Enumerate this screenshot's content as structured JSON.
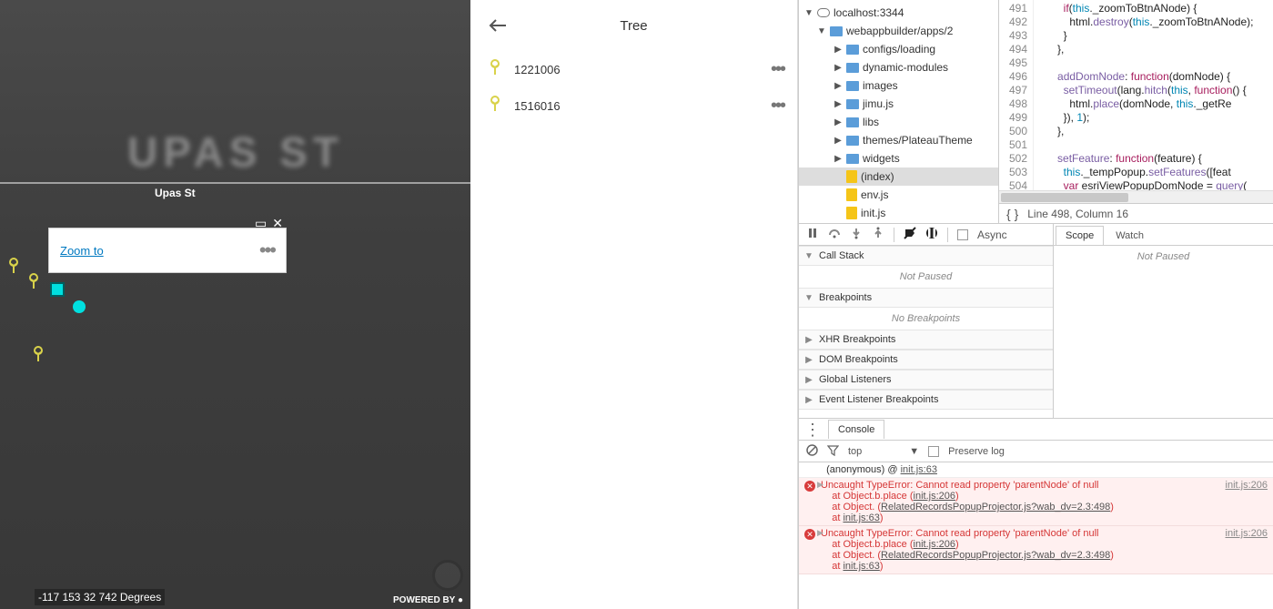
{
  "map": {
    "street": "Upas St",
    "ghost": "UPAS ST",
    "popup_link": "Zoom to",
    "coords": "-117 153 32 742 Degrees",
    "powered": "POWERED BY"
  },
  "list": {
    "title": "Tree",
    "items": [
      {
        "label": "1221006"
      },
      {
        "label": "1516016"
      }
    ]
  },
  "devtools": {
    "sources": {
      "domain": "localhost:3344",
      "nodes": [
        {
          "label": "webappbuilder/apps/2",
          "type": "folder-open",
          "indent": 1,
          "expand": "▼"
        },
        {
          "label": "configs/loading",
          "type": "folder",
          "indent": 2,
          "expand": "▶"
        },
        {
          "label": "dynamic-modules",
          "type": "folder",
          "indent": 2,
          "expand": "▶"
        },
        {
          "label": "images",
          "type": "folder",
          "indent": 2,
          "expand": "▶"
        },
        {
          "label": "jimu.js",
          "type": "folder",
          "indent": 2,
          "expand": "▶"
        },
        {
          "label": "libs",
          "type": "folder",
          "indent": 2,
          "expand": "▶"
        },
        {
          "label": "themes/PlateauTheme",
          "type": "folder",
          "indent": 2,
          "expand": "▶"
        },
        {
          "label": "widgets",
          "type": "folder",
          "indent": 2,
          "expand": "▶"
        },
        {
          "label": "(index)",
          "type": "file",
          "indent": 2,
          "selected": true
        },
        {
          "label": "env.js",
          "type": "file",
          "indent": 2
        },
        {
          "label": "init.js",
          "type": "file",
          "indent": 2
        }
      ]
    },
    "code": {
      "first_line": 491,
      "lines": [
        "        if(this._zoomToBtnANode) {",
        "          html.destroy(this._zoomToBtnANode);",
        "        }",
        "      },",
        "",
        "      addDomNode: function(domNode) {",
        "        setTimeout(lang.hitch(this, function() {",
        "          html.place(domNode, this._getRe",
        "        }), 1);",
        "      },",
        "",
        "      setFeature: function(feature) {",
        "        this._tempPopup.setFeatures([feat",
        "        var esriViewPopupDomNode = query(",
        ""
      ],
      "status": "Line 498, Column 16"
    },
    "debugger": {
      "async": "Async",
      "panels": [
        {
          "title": "Call Stack",
          "msg": "Not Paused",
          "open": true
        },
        {
          "title": "Breakpoints",
          "msg": "No Breakpoints",
          "open": true
        },
        {
          "title": "XHR Breakpoints"
        },
        {
          "title": "DOM Breakpoints"
        },
        {
          "title": "Global Listeners"
        },
        {
          "title": "Event Listener Breakpoints"
        }
      ],
      "right": {
        "tabs": [
          "Scope",
          "Watch"
        ],
        "msg": "Not Paused"
      }
    },
    "console": {
      "tab": "Console",
      "context": "top",
      "preserve": "Preserve log",
      "lines": [
        {
          "type": "norm",
          "text": "(anonymous) @ ",
          "link": "init.js:63"
        },
        {
          "type": "err",
          "head": "Uncaught TypeError: Cannot read property 'parentNode' of null",
          "src": "init.js:206",
          "stack": [
            {
              "label": "at Object.b.place (",
              "link": "init.js:206"
            },
            {
              "label": "at Object.<anonymous> (",
              "link": "RelatedRecordsPopupProjector.js?wab_dv=2.3:498"
            },
            {
              "label": "at ",
              "link": "init.js:63"
            }
          ]
        },
        {
          "type": "err",
          "head": "Uncaught TypeError: Cannot read property 'parentNode' of null",
          "src": "init.js:206",
          "stack": [
            {
              "label": "at Object.b.place (",
              "link": "init.js:206"
            },
            {
              "label": "at Object.<anonymous> (",
              "link": "RelatedRecordsPopupProjector.js?wab_dv=2.3:498"
            },
            {
              "label": "at ",
              "link": "init.js:63"
            }
          ]
        }
      ]
    }
  }
}
